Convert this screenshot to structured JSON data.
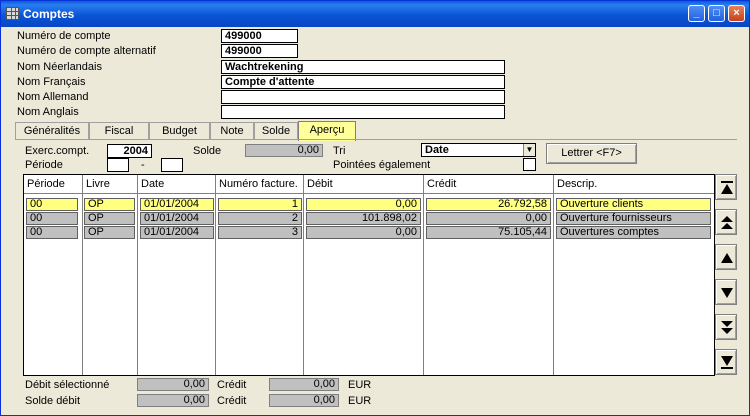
{
  "window": {
    "title": "Comptes"
  },
  "header": {
    "fields": [
      {
        "label": "Numéro de compte",
        "value": "499000"
      },
      {
        "label": "Numéro de compte alternatif",
        "value": "499000"
      },
      {
        "label": "Nom Néerlandais",
        "value": "Wachtrekening"
      },
      {
        "label": "Nom Français",
        "value": "Compte d'attente"
      },
      {
        "label": "Nom Allemand",
        "value": ""
      },
      {
        "label": "Nom Anglais",
        "value": ""
      }
    ]
  },
  "tabs": [
    {
      "label": "Généralités",
      "active": false
    },
    {
      "label": "Fiscal",
      "active": false
    },
    {
      "label": "Budget",
      "active": false
    },
    {
      "label": "Note",
      "active": false
    },
    {
      "label": "Solde",
      "active": false
    },
    {
      "label": "Aperçu",
      "active": true
    }
  ],
  "filters": {
    "exercise_label": "Exerc.compt.",
    "exercise_value": "2004",
    "period_label": "Période",
    "period_sep": "-",
    "solde_label": "Solde",
    "solde_value": "0,00",
    "sort_label": "Tri",
    "sort_value": "Date",
    "pointed_label": "Pointées également",
    "letter_button": "Lettrer <F7>"
  },
  "table": {
    "columns": [
      "Période",
      "Livre",
      "Date",
      "Numéro facture.",
      "Débit",
      "Crédit",
      "Descrip."
    ],
    "rows": [
      {
        "period": "00",
        "book": "OP",
        "date": "01/01/2004",
        "invoice": "1",
        "debit": "0,00",
        "credit": "26.792,58",
        "desc": "Ouverture clients",
        "selected": true
      },
      {
        "period": "00",
        "book": "OP",
        "date": "01/01/2004",
        "invoice": "2",
        "debit": "101.898,02",
        "credit": "0,00",
        "desc": "Ouverture fournisseurs",
        "selected": false
      },
      {
        "period": "00",
        "book": "OP",
        "date": "01/01/2004",
        "invoice": "3",
        "debit": "0,00",
        "credit": "75.105,44",
        "desc": "Ouvertures comptes",
        "selected": false
      }
    ]
  },
  "footer": {
    "selected_debit_label": "Débit sélectionné",
    "selected_debit_value": "0,00",
    "selected_credit_label": "Crédit",
    "selected_credit_value": "0,00",
    "currency1": "EUR",
    "debit_balance_label": "Solde débit",
    "debit_balance_value": "0,00",
    "balance_credit_label": "Crédit",
    "balance_credit_value": "0,00",
    "currency2": "EUR"
  },
  "colors": {
    "titlebar": "#0a55d4",
    "selected_row": "#ffff80",
    "active_tab": "#ffff99"
  }
}
